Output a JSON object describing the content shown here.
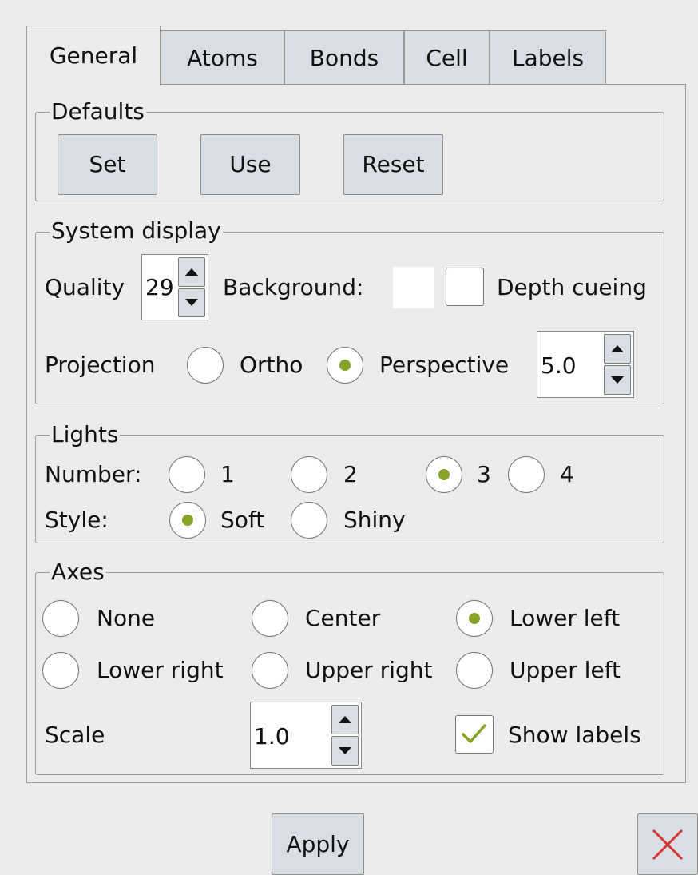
{
  "tabs": [
    {
      "label": "General",
      "active": true
    },
    {
      "label": "Atoms",
      "active": false
    },
    {
      "label": "Bonds",
      "active": false
    },
    {
      "label": "Cell",
      "active": false
    },
    {
      "label": "Labels",
      "active": false
    }
  ],
  "defaults": {
    "legend": "Defaults",
    "set_label": "Set",
    "use_label": "Use",
    "reset_label": "Reset"
  },
  "system_display": {
    "legend": "System display",
    "quality_label": "Quality",
    "quality_value": "29",
    "background_label": "Background:",
    "background_color": "#ffffff",
    "depth_cueing_label": "Depth cueing",
    "depth_cueing_checked": false,
    "projection_label": "Projection",
    "ortho_label": "Ortho",
    "perspective_label": "Perspective",
    "projection_selected": "Perspective",
    "perspective_value": "5.0"
  },
  "lights": {
    "legend": "Lights",
    "number_label": "Number:",
    "number_options": [
      "1",
      "2",
      "3",
      "4"
    ],
    "number_selected": "3",
    "style_label": "Style:",
    "style_options": [
      "Soft",
      "Shiny"
    ],
    "style_selected": "Soft"
  },
  "axes": {
    "legend": "Axes",
    "options": [
      "None",
      "Center",
      "Lower left",
      "Lower right",
      "Upper right",
      "Upper left"
    ],
    "selected": "Lower left",
    "scale_label": "Scale",
    "scale_value": "1.0",
    "show_labels_label": "Show labels",
    "show_labels_checked": true
  },
  "footer": {
    "apply_label": "Apply",
    "close_icon": "close-icon"
  },
  "colors": {
    "accent": "#88a32a",
    "close": "#d9342b",
    "button": "#d9dde4"
  }
}
